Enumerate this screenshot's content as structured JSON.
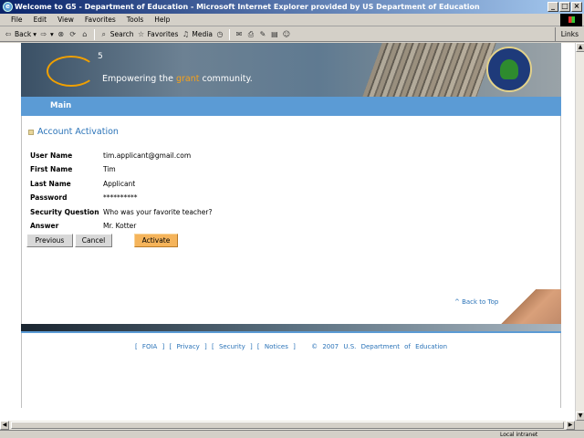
{
  "window": {
    "title": "Welcome to G5 - Department of Education - Microsoft Internet Explorer provided by US Department of Education"
  },
  "menu": [
    "File",
    "Edit",
    "View",
    "Favorites",
    "Tools",
    "Help"
  ],
  "toolbar": {
    "back": "Back",
    "search": "Search",
    "favorites": "Favorites",
    "media": "Media",
    "links": "Links"
  },
  "banner": {
    "superscript": "5",
    "tagline_pre": "Empowering the ",
    "tagline_highlight": "grant",
    "tagline_post": " community."
  },
  "nav": {
    "main": "Main"
  },
  "section": {
    "title": "Account Activation"
  },
  "fields": [
    {
      "label": "User Name",
      "value": "tim.applicant@gmail.com"
    },
    {
      "label": "First Name",
      "value": "Tim"
    },
    {
      "label": "Last Name",
      "value": "Applicant"
    },
    {
      "label": "Password",
      "value": "**********"
    },
    {
      "label": "Security Question",
      "value": "Who was your favorite teacher?"
    },
    {
      "label": "Answer",
      "value": "Mr. Kotter"
    }
  ],
  "buttons": {
    "previous": "Previous",
    "cancel": "Cancel",
    "activate": "Activate"
  },
  "back_to_top": "^ Back to Top",
  "footer": {
    "foia": "[ FOIA ]",
    "privacy": "[ Privacy ]",
    "security": "[ Security ]",
    "notices": "[ Notices ]",
    "copyright": "© 2007 U.S. Department of Education"
  },
  "status": {
    "zone": "Local intranet"
  },
  "colors": {
    "accent": "#5b9bd5",
    "link": "#2a73b8",
    "activate": "#f5b45b",
    "grant": "#f7a11a"
  }
}
